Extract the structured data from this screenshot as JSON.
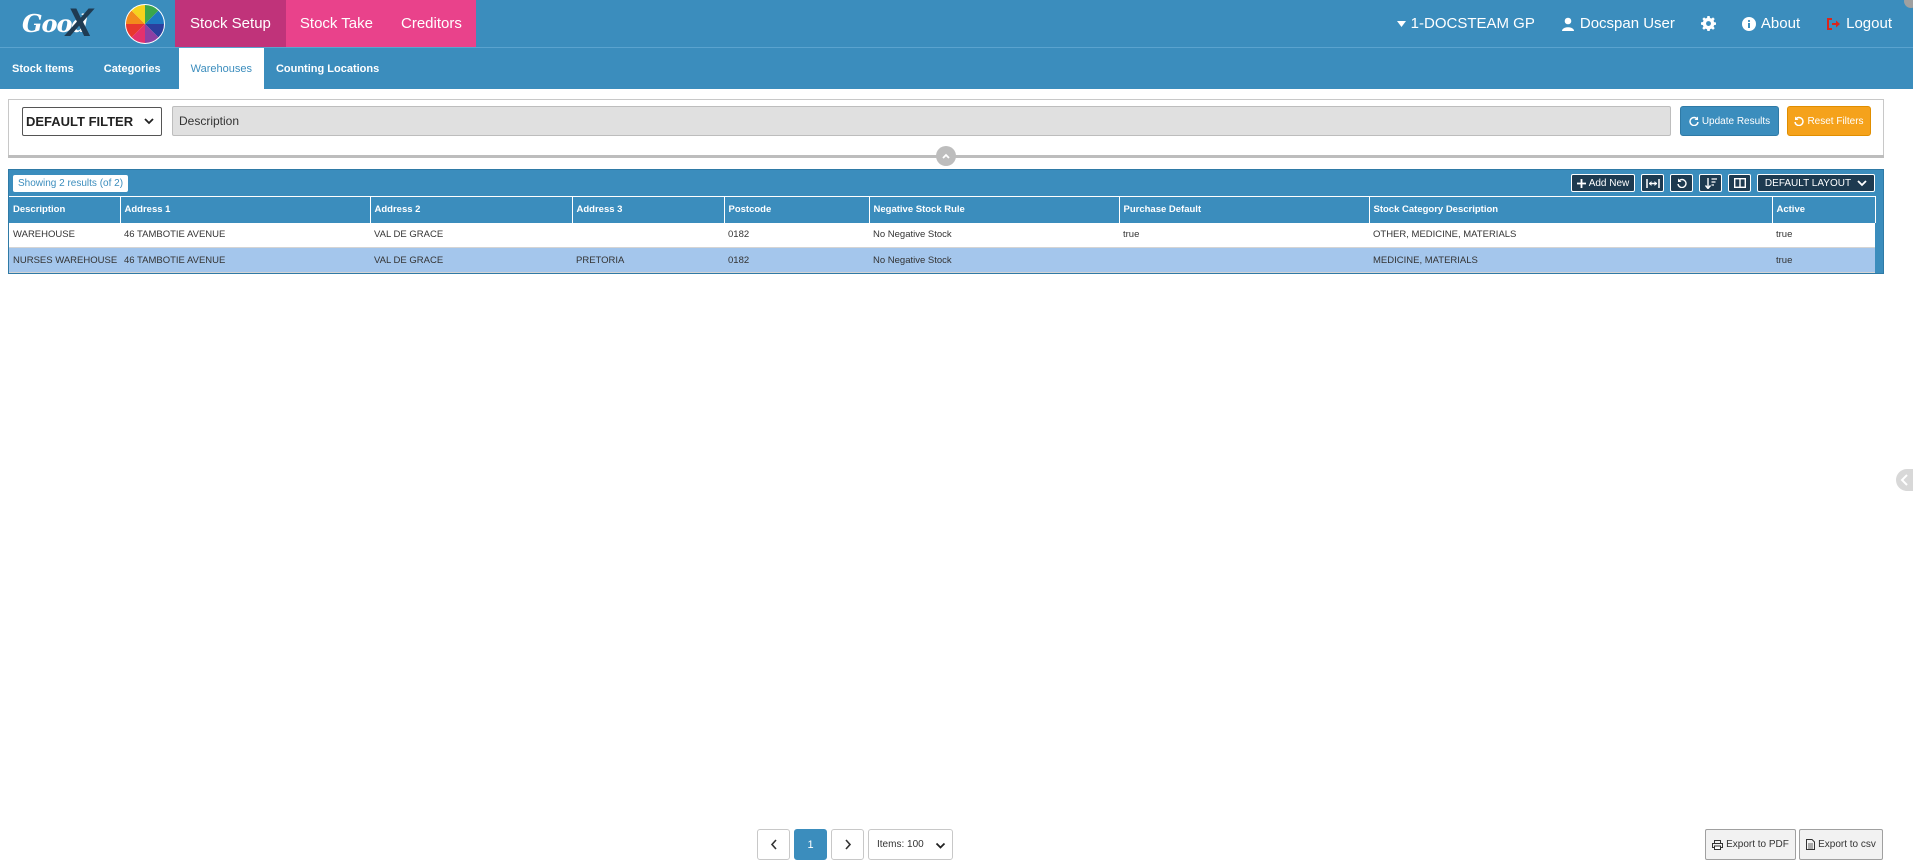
{
  "header": {
    "logo_text": "Good",
    "logo_mark": "X",
    "tabs": [
      {
        "label": "Stock Setup",
        "active": true
      },
      {
        "label": "Stock Take",
        "active": false
      },
      {
        "label": "Creditors",
        "active": false
      }
    ],
    "practice": "1-DOCSTEAM GP",
    "user": "Docspan User",
    "about": "About",
    "logout": "Logout"
  },
  "subnav": {
    "tabs": [
      {
        "label": "Stock Items",
        "active": false
      },
      {
        "label": "Categories",
        "active": false
      },
      {
        "label": "Warehouses",
        "active": true
      },
      {
        "label": "Counting Locations",
        "active": false
      }
    ]
  },
  "filter": {
    "selected": "DEFAULT FILTER",
    "description_value": "Description",
    "update_label": "Update Results",
    "reset_label": "Reset Filters"
  },
  "grid": {
    "showing": "Showing 2 results (of 2)",
    "add_new": "Add New",
    "layout": "DEFAULT LAYOUT",
    "columns": [
      "Description",
      "Address 1",
      "Address 2",
      "Address 3",
      "Postcode",
      "Negative Stock Rule",
      "Purchase Default",
      "Stock Category Description",
      "Active"
    ],
    "rows": [
      [
        "WAREHOUSE",
        "46 TAMBOTIE AVENUE",
        "VAL DE GRACE",
        "",
        "0182",
        "No Negative Stock",
        "true",
        "OTHER, MEDICINE, MATERIALS",
        "true"
      ],
      [
        "NURSES WAREHOUSE",
        "46 TAMBOTIE AVENUE",
        "VAL DE GRACE",
        "PRETORIA",
        "0182",
        "No Negative Stock",
        "",
        "MEDICINE, MATERIALS",
        "true"
      ]
    ]
  },
  "pager": {
    "current_page": "1",
    "items_per_page": "Items: 100"
  },
  "exports": {
    "pdf": "Export to PDF",
    "csv": "Export to csv"
  },
  "colors": {
    "primary": "#3b8dbd",
    "pink": "#e9428b",
    "pink_active": "#c0337a",
    "orange": "#f5a21b",
    "row_selected": "#a4c6ec"
  }
}
